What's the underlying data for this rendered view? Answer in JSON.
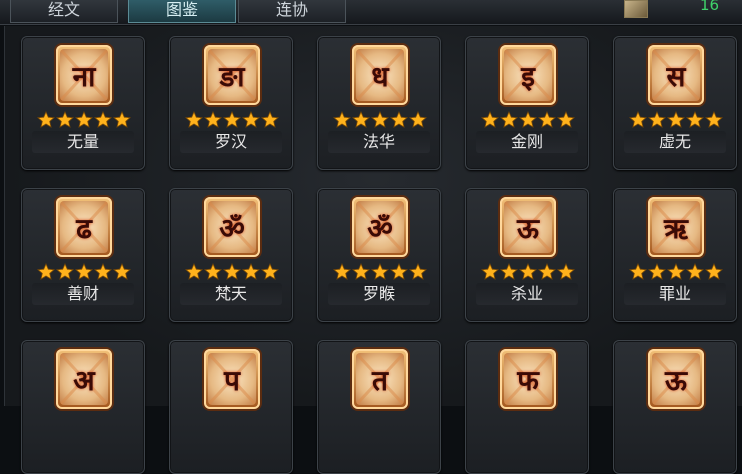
{
  "tabs": [
    {
      "label": "经文",
      "active": false
    },
    {
      "label": "图鉴",
      "active": true
    },
    {
      "label": "连协",
      "active": false
    }
  ],
  "counter": "16",
  "colors": {
    "star": "#ffb21c",
    "glyph": "#3a0a06",
    "accent": "#2f5d68"
  },
  "cards": [
    {
      "name": "无量",
      "glyph": "ना",
      "stars": 5
    },
    {
      "name": "罗汉",
      "glyph": "ङा",
      "stars": 5
    },
    {
      "name": "法华",
      "glyph": "ध",
      "stars": 5
    },
    {
      "name": "金刚",
      "glyph": "इ",
      "stars": 5
    },
    {
      "name": "虚无",
      "glyph": "स",
      "stars": 5
    },
    {
      "name": "善财",
      "glyph": "ढ",
      "stars": 5
    },
    {
      "name": "梵天",
      "glyph": "ॐ",
      "stars": 5
    },
    {
      "name": "罗睺",
      "glyph": "ॐ",
      "stars": 5
    },
    {
      "name": "杀业",
      "glyph": "ऊ",
      "stars": 5
    },
    {
      "name": "罪业",
      "glyph": "ऋ",
      "stars": 5
    },
    {
      "name": "",
      "glyph": "अ",
      "stars": 0
    },
    {
      "name": "",
      "glyph": "प",
      "stars": 0
    },
    {
      "name": "",
      "glyph": "त",
      "stars": 0
    },
    {
      "name": "",
      "glyph": "फ",
      "stars": 0
    },
    {
      "name": "",
      "glyph": "ऊ",
      "stars": 0
    }
  ]
}
